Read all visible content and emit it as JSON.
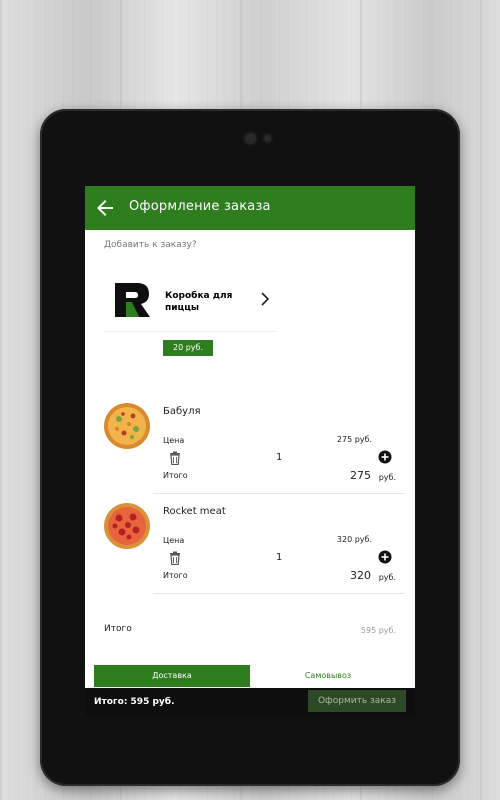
{
  "header": {
    "title": "Оформление заказа"
  },
  "addon": {
    "prompt": "Добавить к заказу?",
    "name": "Коробка для пиццы",
    "price": "20 руб."
  },
  "cart": {
    "items": [
      {
        "name": "Бабуля",
        "price_label": "Цена",
        "unit_price": "275 руб.",
        "quantity": "1",
        "total_label": "Итого",
        "total_value": "275",
        "currency": "руб."
      },
      {
        "name": "Rocket meat",
        "price_label": "Цена",
        "unit_price": "320 руб.",
        "quantity": "1",
        "total_label": "Итого",
        "total_value": "320",
        "currency": "руб."
      }
    ]
  },
  "order": {
    "total_label": "Итого",
    "total_value": "595 руб."
  },
  "delivery_tabs": {
    "delivery": "Доставка",
    "pickup": "Самовывоз",
    "selected": "delivery"
  },
  "bottom_bar": {
    "total": "Итого: 595 руб.",
    "checkout": "Оформить заказ"
  },
  "colors": {
    "primary": "#2e7d1f",
    "bottom_bar": "#0e0e0e",
    "checkout_disabled": "#2c4a26"
  },
  "icons": [
    "back-arrow-icon",
    "chevron-right-icon",
    "trash-icon",
    "plus-circle-icon",
    "logo-r-icon"
  ]
}
